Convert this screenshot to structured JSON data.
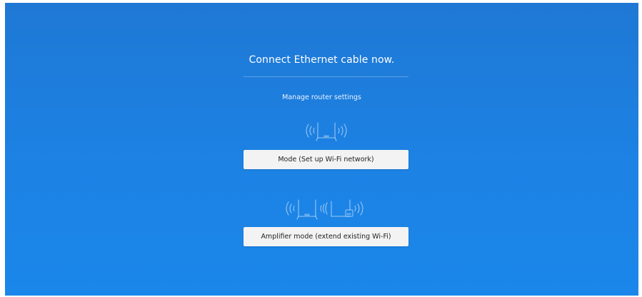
{
  "heading": "Connect Ethernet cable now.",
  "subheading": "Manage router settings",
  "options": {
    "router_mode_label": "Mode (Set up Wi-Fi network)",
    "amplifier_mode_label": "Amplifier mode (extend existing Wi-Fi)"
  },
  "icons": {
    "router_mode_icon": "router-wifi-icon",
    "amplifier_mode_icon": "router-repeater-icon"
  },
  "colors": {
    "background_top": "#1f78d4",
    "background_bottom": "#1b87ea",
    "button_bg": "#f3f3f3",
    "text": "#ffffff"
  }
}
